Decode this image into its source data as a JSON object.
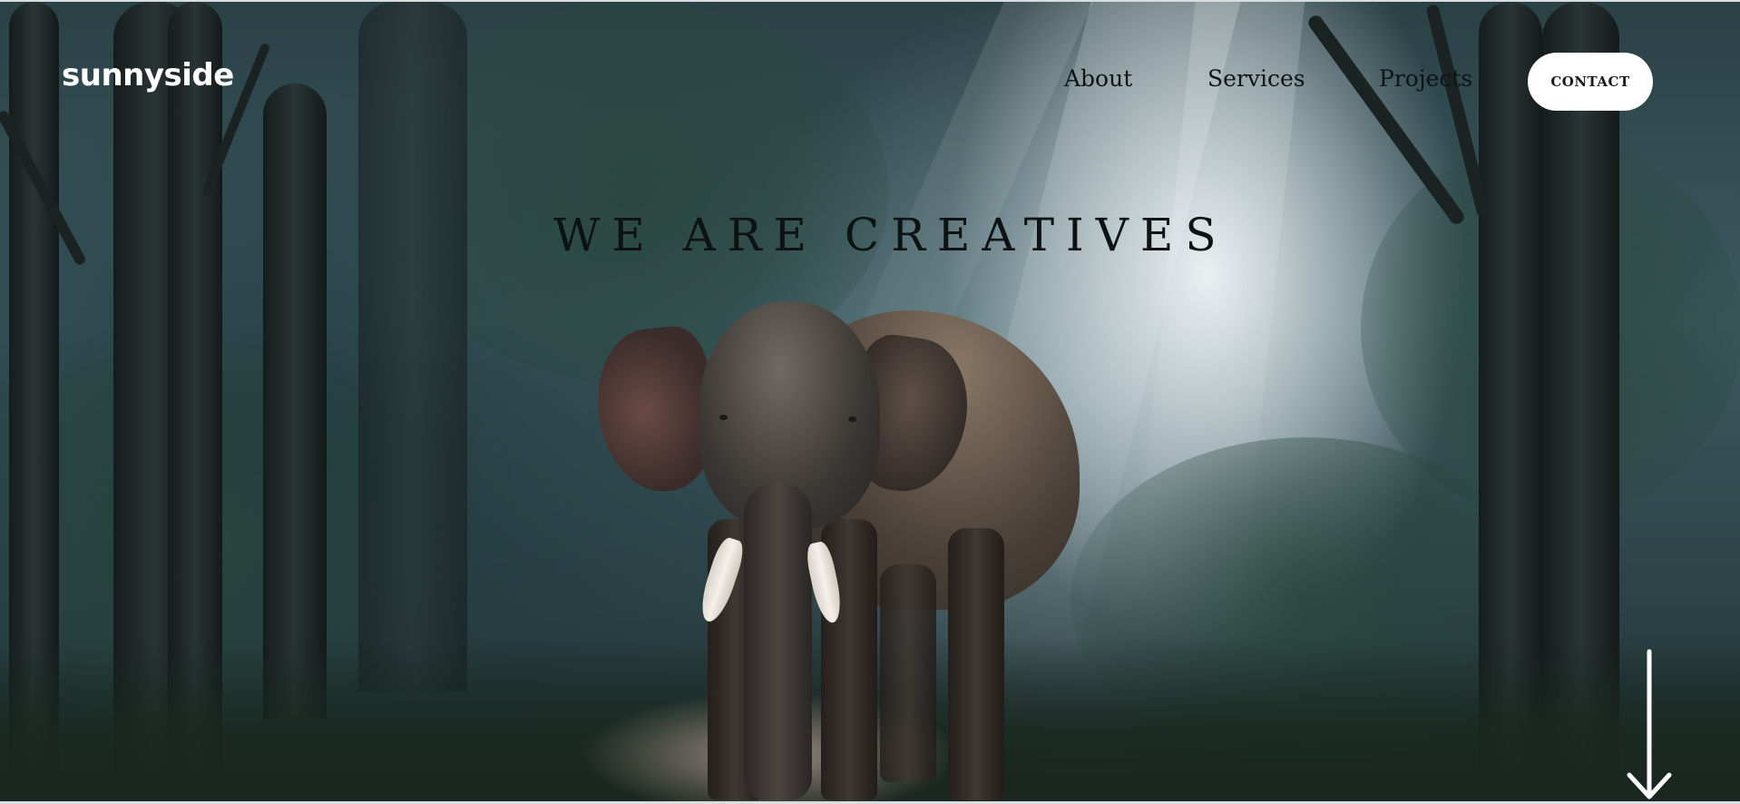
{
  "brand": {
    "logo": "sunnyside"
  },
  "nav": {
    "items": [
      {
        "label": "About"
      },
      {
        "label": "Services"
      },
      {
        "label": "Projects"
      }
    ],
    "contact_label": "CONTACT"
  },
  "hero": {
    "headline": "WE ARE CREATIVES",
    "background_image": "forest-elephant-photo",
    "scroll_icon": "arrow-down-icon"
  },
  "colors": {
    "nav_text": "#0f1414",
    "button_bg": "#ffffff",
    "logo": "#ffffff"
  }
}
